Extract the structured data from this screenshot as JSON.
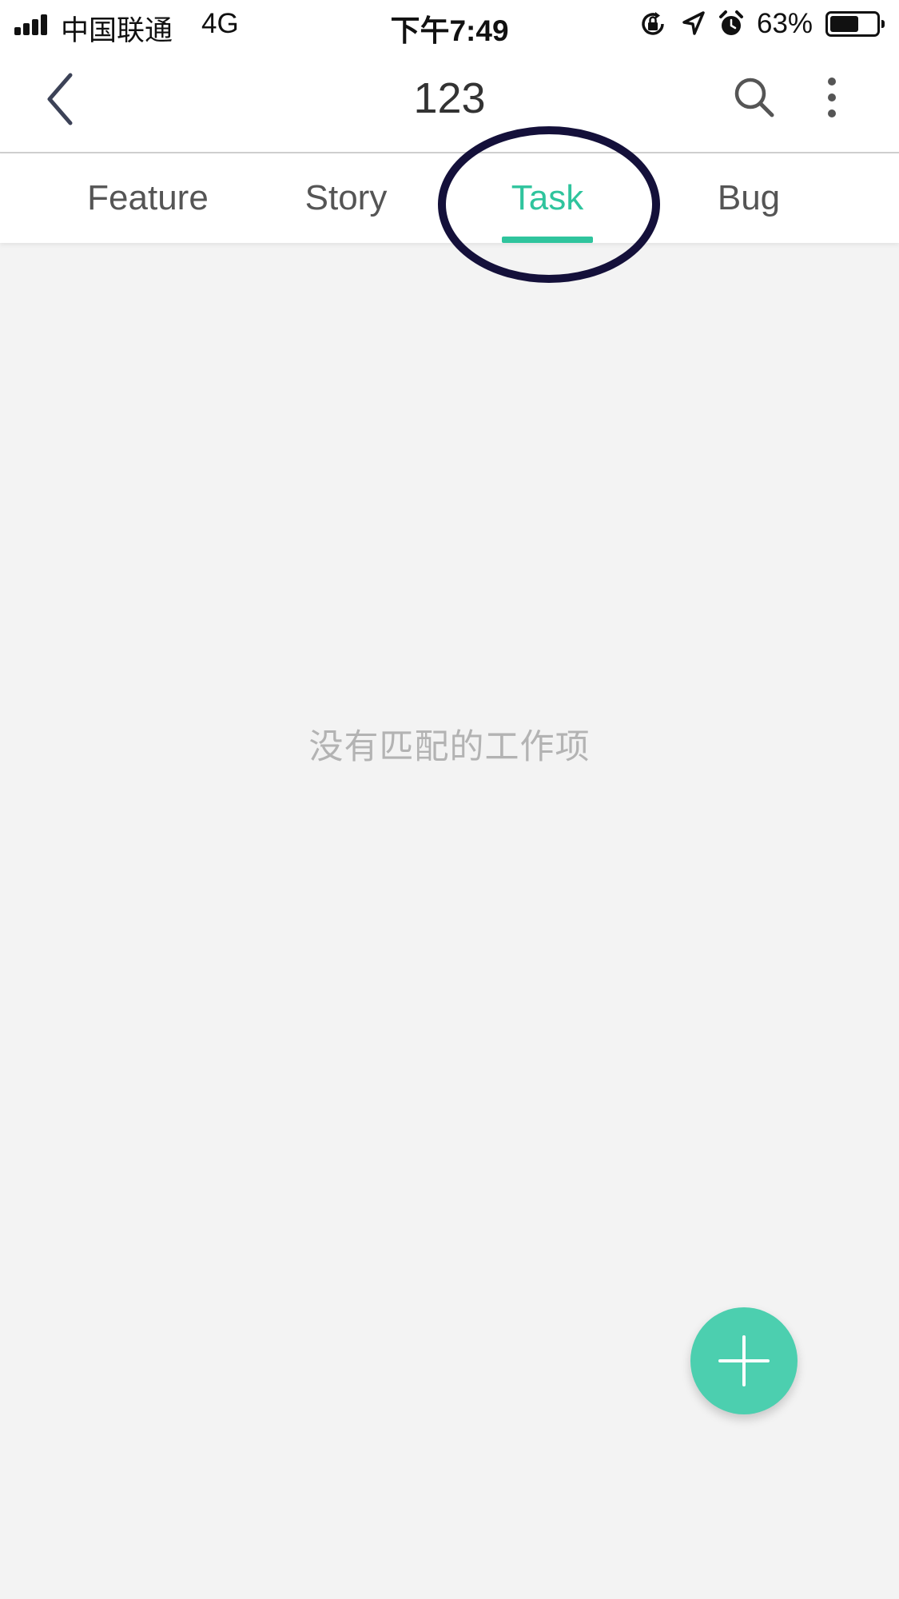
{
  "status_bar": {
    "carrier": "中国联通",
    "network": "4G",
    "time": "下午7:49",
    "battery_percent": "63%",
    "battery_level": 0.63,
    "icons": [
      "signal-icon",
      "rotation-lock-icon",
      "location-icon",
      "alarm-icon",
      "battery-icon"
    ]
  },
  "nav": {
    "title": "123",
    "back_icon": "chevron-left-icon",
    "search_icon": "search-icon",
    "more_icon": "more-vertical-icon"
  },
  "tabs": [
    {
      "label": "Feature",
      "active": false
    },
    {
      "label": "Story",
      "active": false
    },
    {
      "label": "Task",
      "active": true
    },
    {
      "label": "Bug",
      "active": false
    }
  ],
  "empty_state": {
    "message": "没有匹配的工作项"
  },
  "fab": {
    "icon": "plus-icon"
  },
  "colors": {
    "accent": "#2fc49d",
    "fab": "#4ccfaf",
    "background": "#f3f3f3",
    "annotation": "#14103a"
  }
}
